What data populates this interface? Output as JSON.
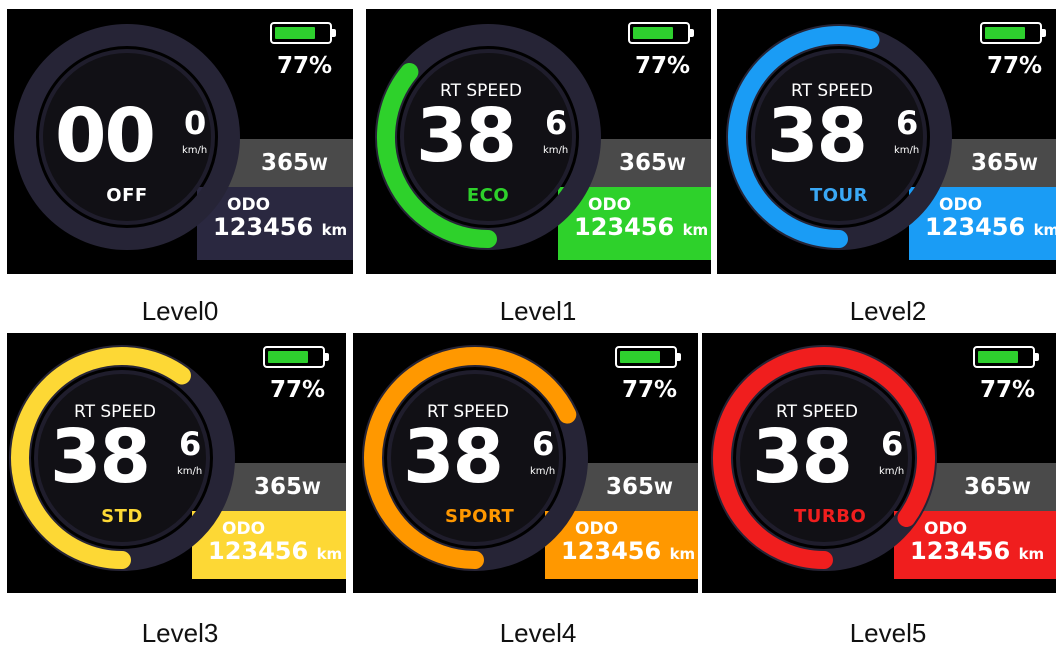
{
  "panels": [
    {
      "caption": "Level0",
      "speed_int": "00",
      "speed_dec": "0",
      "speed_unit": "km/h",
      "header_label": "",
      "mode": "OFF",
      "power": "365",
      "power_unit": "W",
      "battery_pct": "77%",
      "battery_level": 0.77,
      "odo_label": "ODO",
      "odo_value": "123456",
      "odo_unit": "km",
      "color": "#2a2840",
      "mode_color": "#ffffff",
      "arc_fraction": 0
    },
    {
      "caption": "Level1",
      "speed_int": "38",
      "speed_dec": "6",
      "speed_unit": "km/h",
      "header_label": "RT SPEED",
      "mode": "ECO",
      "power": "365",
      "power_unit": "W",
      "battery_pct": "77%",
      "battery_level": 0.77,
      "odo_label": "ODO",
      "odo_value": "123456",
      "odo_unit": "km",
      "color": "#2ed12b",
      "mode_color": "#2ed12b",
      "arc_fraction": 0.36
    },
    {
      "caption": "Level2",
      "speed_int": "38",
      "speed_dec": "6",
      "speed_unit": "km/h",
      "header_label": "RT SPEED",
      "mode": "TOUR",
      "power": "365",
      "power_unit": "W",
      "battery_pct": "77%",
      "battery_level": 0.77,
      "odo_label": "ODO",
      "odo_value": "123456",
      "odo_unit": "km",
      "color": "#1a9cf5",
      "mode_color": "#3aa8f5",
      "arc_fraction": 0.55
    },
    {
      "caption": "Level3",
      "speed_int": "38",
      "speed_dec": "6",
      "speed_unit": "km/h",
      "header_label": "RT SPEED",
      "mode": "STD",
      "power": "365",
      "power_unit": "W",
      "battery_pct": "77%",
      "battery_level": 0.77,
      "odo_label": "ODO",
      "odo_value": "123456",
      "odo_unit": "km",
      "color": "#fdd835",
      "mode_color": "#fdd835",
      "arc_fraction": 0.6
    },
    {
      "caption": "Level4",
      "speed_int": "38",
      "speed_dec": "6",
      "speed_unit": "km/h",
      "header_label": "RT SPEED",
      "mode": "SPORT",
      "power": "365",
      "power_unit": "W",
      "battery_pct": "77%",
      "battery_level": 0.77,
      "odo_label": "ODO",
      "odo_value": "123456",
      "odo_unit": "km",
      "color": "#ff9800",
      "mode_color": "#ff9800",
      "arc_fraction": 0.68
    },
    {
      "caption": "Level5",
      "speed_int": "38",
      "speed_dec": "6",
      "speed_unit": "km/h",
      "header_label": "RT SPEED",
      "mode": "TURBO",
      "power": "365",
      "power_unit": "W",
      "battery_pct": "77%",
      "battery_level": 0.77,
      "odo_label": "ODO",
      "odo_value": "123456",
      "odo_unit": "km",
      "color": "#f01e1e",
      "mode_color": "#f01e1e",
      "arc_fraction": 0.85
    }
  ]
}
